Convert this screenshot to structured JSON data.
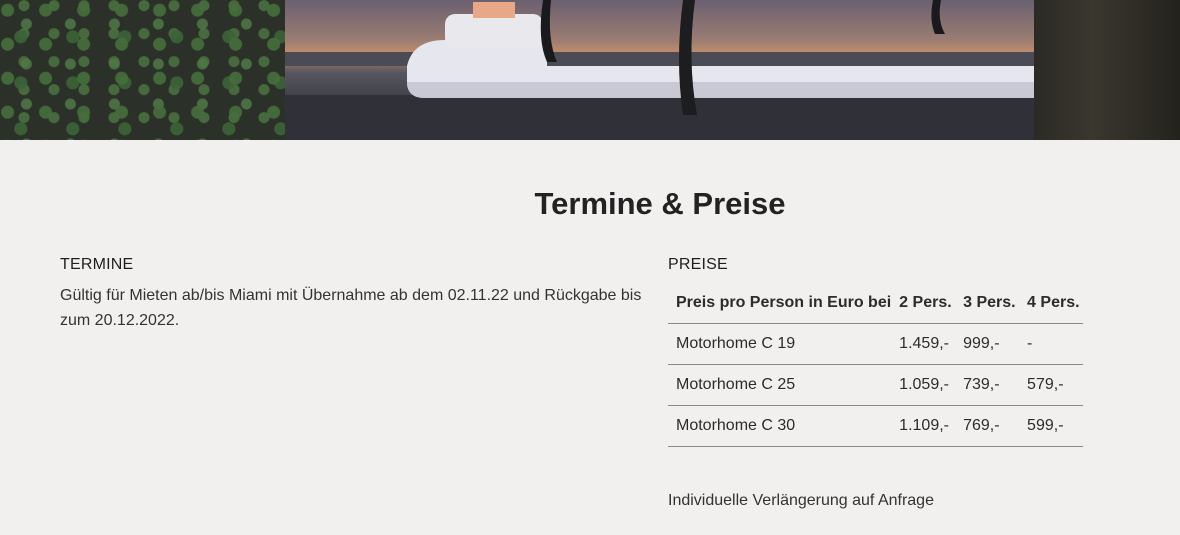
{
  "heading": "Termine & Preise",
  "termine": {
    "title": "TERMINE",
    "text": "Gültig für Mieten ab/bis Miami mit Übernahme ab dem 02.11.22 und Rückgabe bis zum 20.12.2022."
  },
  "preise": {
    "title": "PREISE",
    "columns": [
      "Preis pro Person in Euro bei",
      "2 Pers.",
      "3 Pers.",
      "4 Pers."
    ],
    "rows": [
      [
        "Motorhome C 19",
        "1.459,-",
        "999,-",
        "-"
      ],
      [
        "Motorhome C 25",
        "1.059,-",
        "739,-",
        "579,-"
      ],
      [
        "Motorhome C 30",
        "1.109,-",
        "769,-",
        "599,-"
      ]
    ],
    "note": "Individuelle Verlängerung auf Anfrage"
  }
}
